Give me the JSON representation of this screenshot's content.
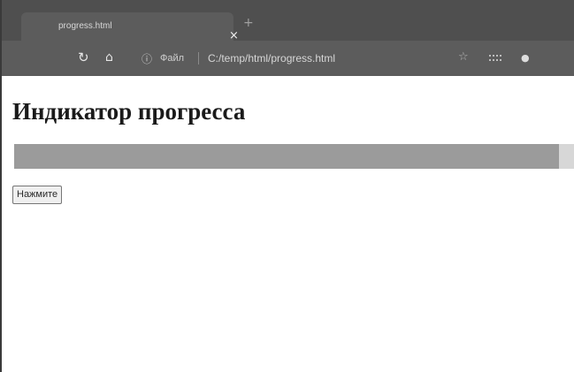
{
  "browser": {
    "tab": {
      "title": "progress.html",
      "close_glyph": "×",
      "new_tab_glyph": "+"
    },
    "toolbar": {
      "reload_icon": "reload-icon",
      "home_icon": "home-icon",
      "info_icon": "info-icon",
      "site_label": "Файл",
      "url": "C:/temp/html/progress.html",
      "bookmark_icon": "star-icon",
      "extensions_icon": "extensions-icon",
      "profile_icon": "profile-icon"
    }
  },
  "page": {
    "title": "Индикатор прогресса",
    "progress": {
      "value_percent": 97
    },
    "button_label": "Нажмите"
  },
  "colors": {
    "tabstrip": "#4f4f4f",
    "toolbar": "#5c5c5c",
    "progress_track": "#d7d7d7",
    "progress_fill": "#9b9b9b"
  }
}
